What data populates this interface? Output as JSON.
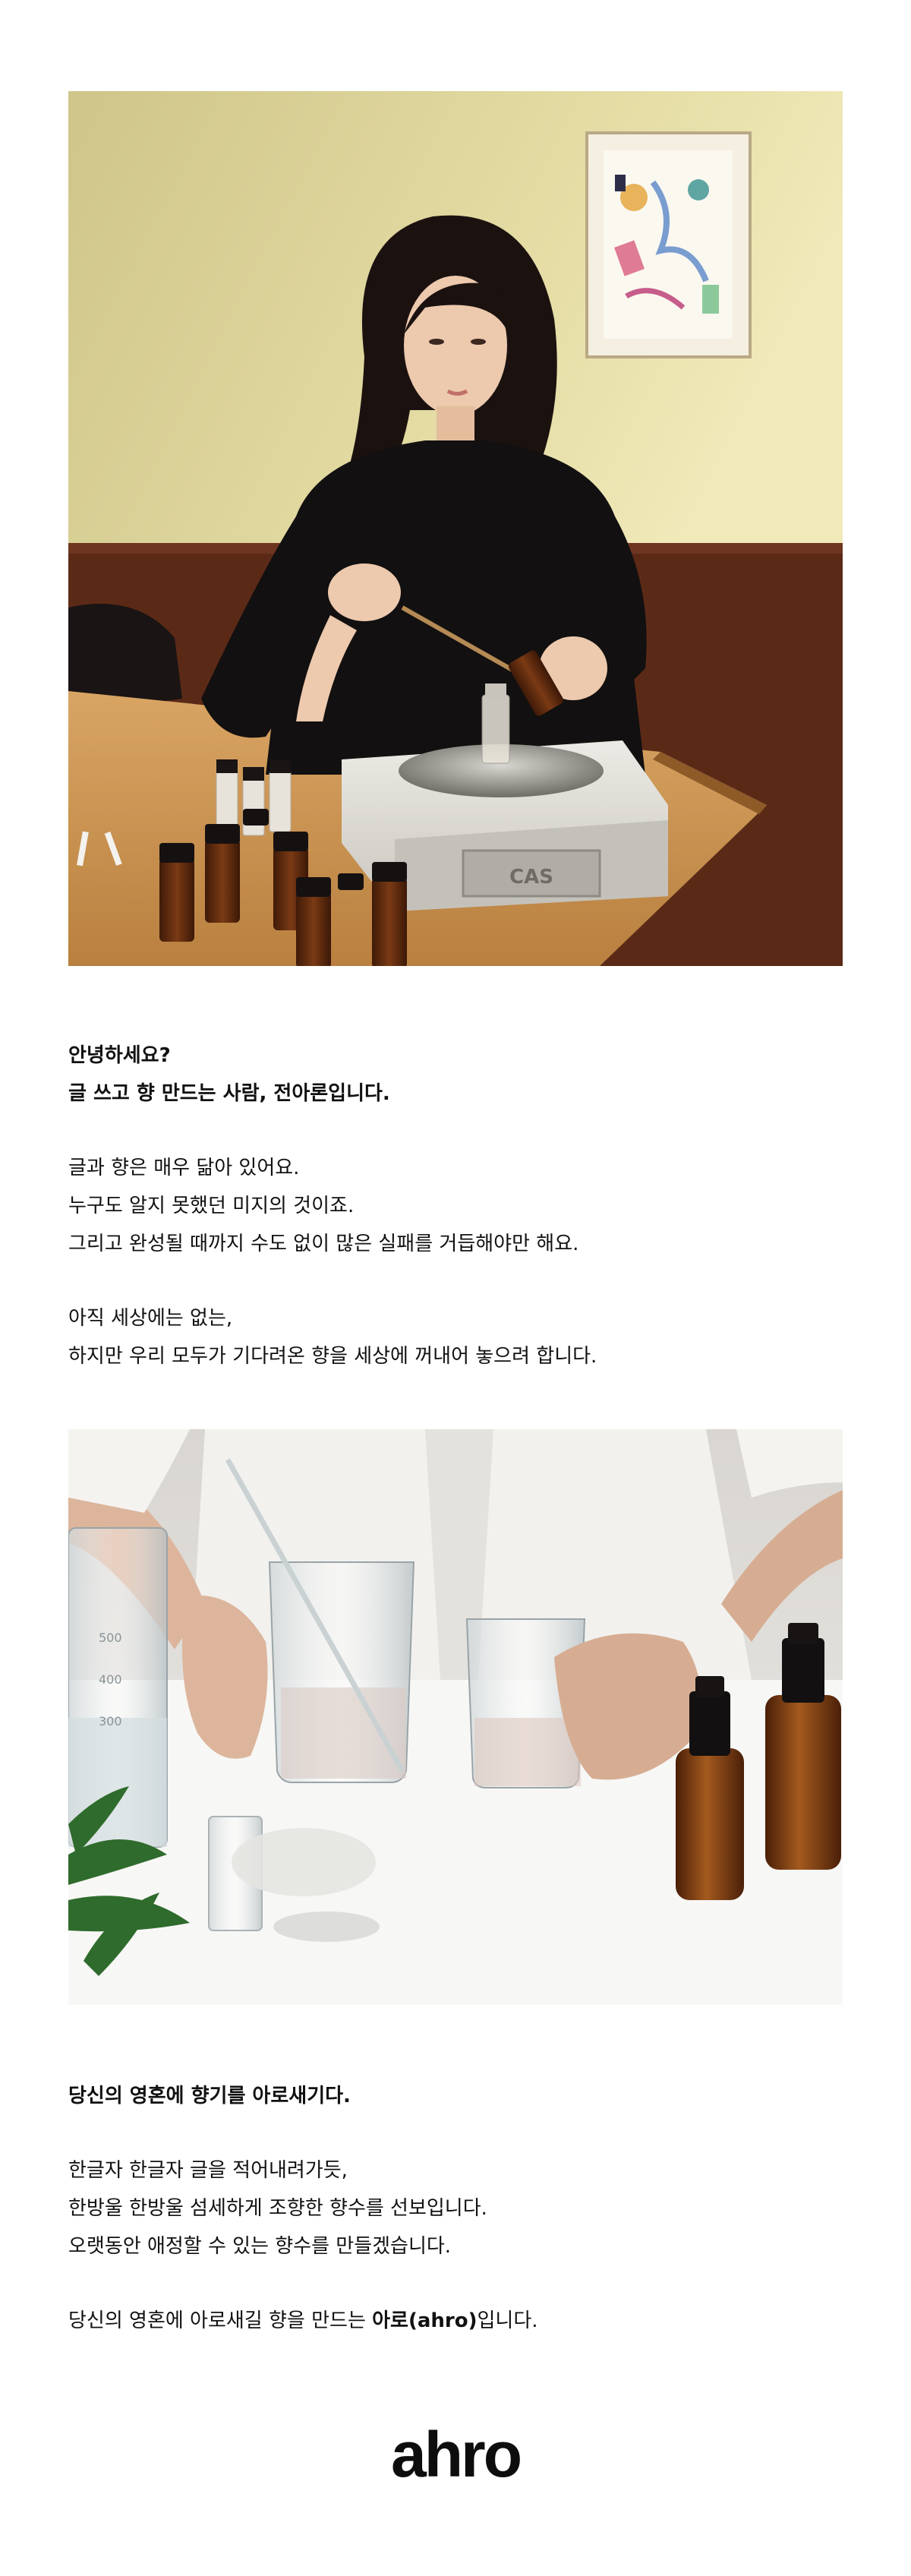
{
  "intro": {
    "greeting": "안녕하세요?",
    "introduction": "글 쓰고 향 만드는 사람, 전아론입니다.",
    "paragraph1": [
      "글과 향은 매우 닮아 있어요.",
      "누구도 알지 못했던 미지의 것이죠.",
      "그리고 완성될 때까지 수도 없이 많은 실패를 거듭해야만 해요."
    ],
    "paragraph2": [
      "아직 세상에는 없는,",
      "하지만 우리 모두가 기다려온 향을 세상에 꺼내어 놓으려 합니다."
    ]
  },
  "brand": {
    "heading": "당신의 영혼에 향기를 아로새기다.",
    "paragraph1": [
      "한글자 한글자 글을 적어내려가듯,",
      "한방울 한방울 섬세하게 조향한 향수를 선보입니다.",
      "오랫동안 애정할 수 있는 향수를 만들겠습니다."
    ],
    "closing_prefix": "당신의 영혼에 아로새길 향을 만드는 ",
    "closing_brand": "아로(ahro)",
    "closing_suffix": "입니다."
  },
  "scale_label": "CAS",
  "beaker_marks": [
    "500",
    "400",
    "300"
  ],
  "logo": "ahro",
  "colors": {
    "wall": "#ddd39a",
    "wainscot": "#5b2a17",
    "table": "#c99458",
    "amber_glass": "#6b2f12",
    "text": "#111111"
  }
}
